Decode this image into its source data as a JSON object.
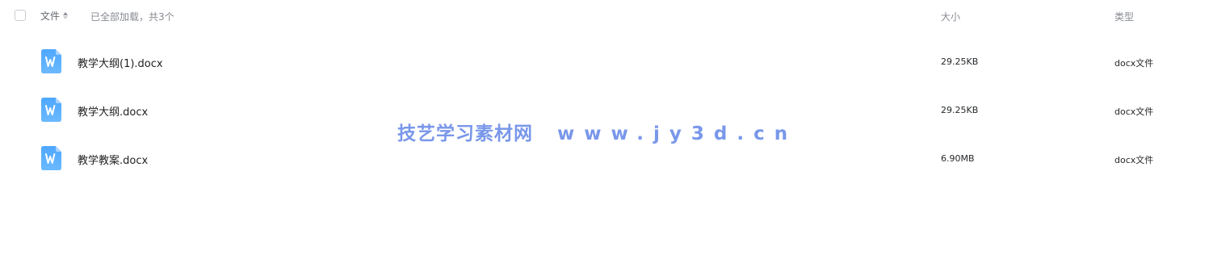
{
  "header": {
    "file_col": "文件",
    "load_status": "已全部加载，共3个",
    "size_col": "大小",
    "type_col": "类型"
  },
  "files": [
    {
      "name": "教学大纲(1).docx",
      "size": "29.25KB",
      "type": "docx文件",
      "icon": "word-doc-icon"
    },
    {
      "name": "教学大纲.docx",
      "size": "29.25KB",
      "type": "docx文件",
      "icon": "word-doc-icon"
    },
    {
      "name": "教学教案.docx",
      "size": "6.90MB",
      "type": "docx文件",
      "icon": "word-doc-icon"
    }
  ],
  "watermark": {
    "site_name": "技艺学习素材网",
    "url": "www.jy3d.cn"
  },
  "colors": {
    "accent": "#4a8cf7",
    "watermark": "#6b8ce8"
  }
}
